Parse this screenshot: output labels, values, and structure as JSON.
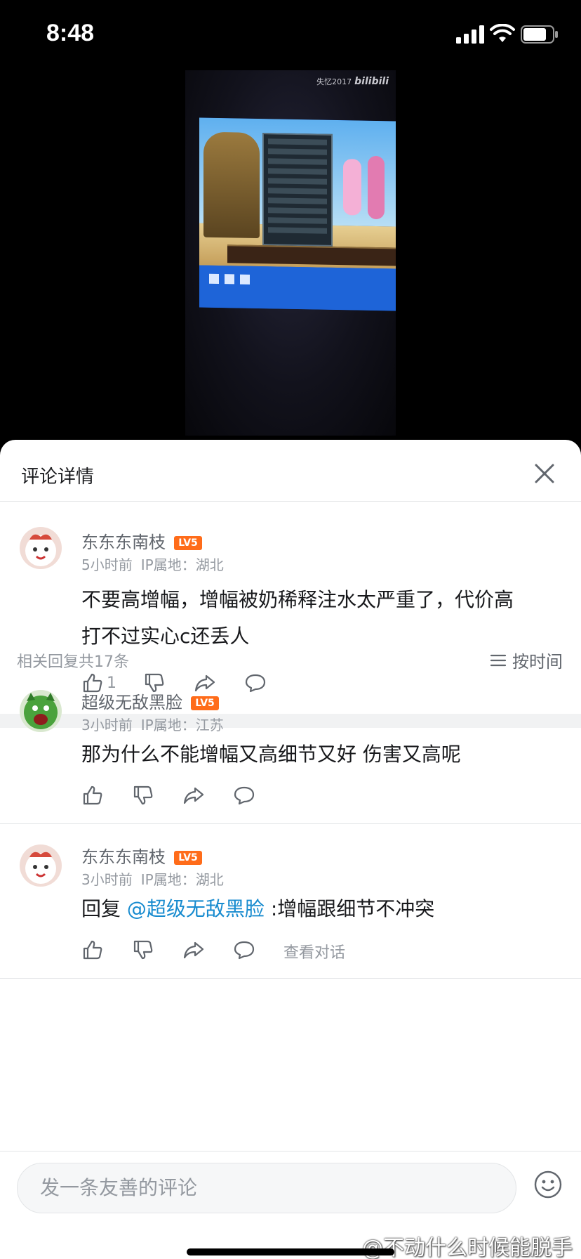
{
  "status_bar": {
    "time": "8:48"
  },
  "video": {
    "watermark_text": "失忆2017",
    "watermark_logo": "bilibili"
  },
  "sheet": {
    "title": "评论详情"
  },
  "main_comment": {
    "username": "东东东南枝",
    "level": "LV5",
    "time": "5小时前",
    "ip": "IP属地：湖北",
    "text_line1": "不要高增幅，增幅被奶稀释注水太严重了，代价高",
    "text_line2": "打不过实心c还丢人",
    "like_count": "1"
  },
  "replies_header": {
    "count_text": "相关回复共17条",
    "sort_label": "按时间"
  },
  "replies": [
    {
      "username": "超级无敌黑脸",
      "level": "LV5",
      "time": "3小时前",
      "ip": "IP属地：江苏",
      "text": "那为什么不能增幅又高细节又好  伤害又高呢"
    },
    {
      "username": "东东东南枝",
      "level": "LV5",
      "time": "3小时前",
      "ip": "IP属地：湖北",
      "reply_prefix": "回复 ",
      "mention": "@超级无敌黑脸",
      "text": " :增幅跟细节不冲突",
      "view_conversation": "查看对话"
    }
  ],
  "input": {
    "placeholder": "发一条友善的评论"
  },
  "credit": "@不动什么时候能脱手",
  "colors": {
    "accent_blue": "#178bcf",
    "level_orange": "#ff6c1a",
    "text_gray": "#9499a0"
  }
}
